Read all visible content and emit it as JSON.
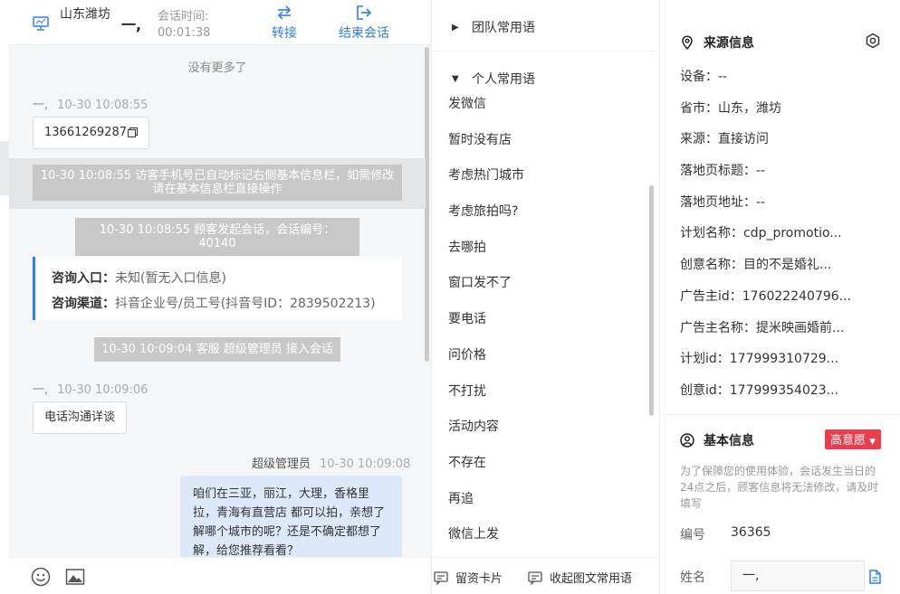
{
  "header": {
    "city": "山东潍坊",
    "visitor": "一,",
    "session_time_label": "会话时间:",
    "session_time": "00:01:38",
    "transfer_label": "转接",
    "end_label": "结束会话"
  },
  "chat": {
    "no_more": "没有更多了",
    "messages": [
      {
        "sender": "一,",
        "time": "10-30 10:08:55",
        "text": "13661269287"
      },
      {
        "text": "10-30 10:08:55 访客手机号已自动标记右侧基本信息栏，如需修改请在基本信息栏直接操作"
      },
      {
        "text": "10-30 10:08:55 顾客发起会话，会话编号：40140"
      },
      {
        "text": "10-30 10:09:04 客服 超级管理员 接入会话"
      },
      {
        "sender": "一,",
        "time": "10-30 10:09:06",
        "text": "电话沟通详谈"
      },
      {
        "sender": "超级管理员",
        "time": "10-30 10:09:08",
        "text": "咱们在三亚，丽江，大理，香格里拉，青海有直营店 都可以拍，亲想了解哪个城市的呢？还是不确定都想了解，给您推荐看看？"
      }
    ],
    "channel": {
      "entry_key": "咨询入口：",
      "entry_val": "未知(暂无入口信息)",
      "channel_key": "咨询渠道：",
      "channel_val": "抖音企业号/员工号(抖音号ID：2839502213)"
    }
  },
  "phrases": {
    "team_label": "团队常用语",
    "personal_label": "个人常用语",
    "items": [
      "发微信",
      "暂时没有店",
      "考虑热门城市",
      "考虑旅拍吗?",
      "去哪拍",
      "窗口发不了",
      "要电话",
      "问价格",
      "不打扰",
      "活动内容",
      "不存在",
      "再追",
      "微信上发"
    ],
    "footer_card": "留资卡片",
    "footer_collapse": "收起图文常用语"
  },
  "info": {
    "source_title": "来源信息",
    "source_rows": [
      "设备：--",
      "省市：山东，潍坊",
      "来源：直接访问",
      "落地页标题：--",
      "落地页地址：--",
      "计划名称：cdp_promotio...",
      "创意名称：目的不是婚礼...",
      "广告主id：176022240796...",
      "广告主名称：提米映画婚前...",
      "计划id：177999310729...",
      "创意id：177999354023..."
    ],
    "basic_title": "基本信息",
    "intent_tag": "高意愿",
    "notice": "为了保障您的使用体验，会话发生当日的24点之后，顾客信息将无法修改，请及时填写",
    "id_label": "编号",
    "id_value": "36365",
    "name_label": "姓名",
    "name_value": "一,"
  },
  "colors": {
    "accent": "#2f7fe8",
    "intent_tag": "#ee3d4a",
    "outgoing_bubble": "#dde9fb"
  }
}
